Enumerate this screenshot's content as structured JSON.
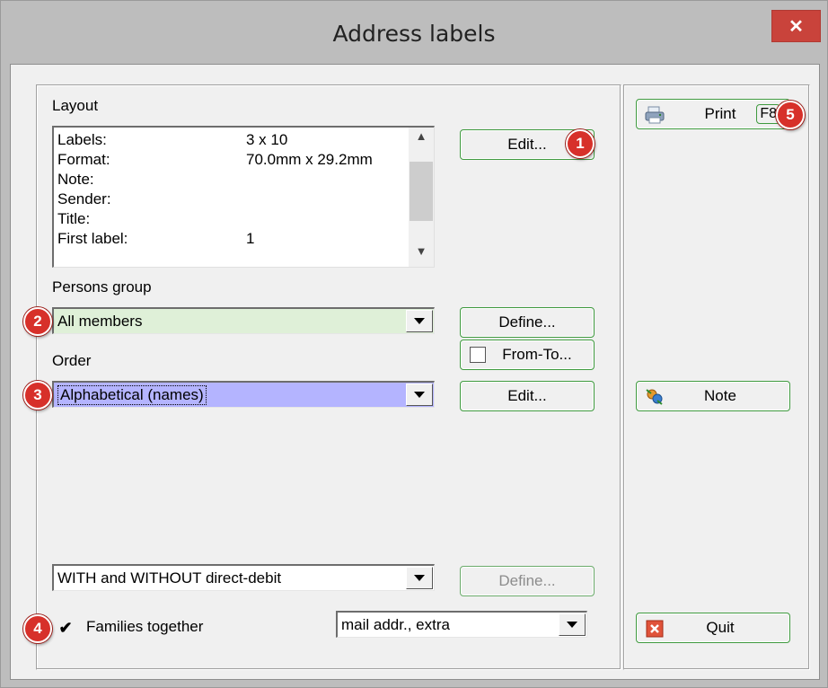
{
  "window": {
    "title": "Address labels",
    "close_glyph": "✕"
  },
  "layout": {
    "label": "Layout",
    "rows": [
      {
        "key": "Labels:",
        "value": "3 x 10"
      },
      {
        "key": "Format:",
        "value": "70.0mm x 29.2mm"
      },
      {
        "key": "Note:",
        "value": ""
      },
      {
        "key": "Sender:",
        "value": ""
      },
      {
        "key": "Title:",
        "value": ""
      },
      {
        "key": "First label:",
        "value": "1"
      }
    ],
    "edit_label": "Edit..."
  },
  "persons_group": {
    "label": "Persons group",
    "value": "All members",
    "define_label": "Define...",
    "from_to_label": "From-To..."
  },
  "order": {
    "label": "Order",
    "value": "Alphabetical (names)",
    "edit_label": "Edit..."
  },
  "debit": {
    "value": "WITH and WITHOUT direct-debit",
    "define_label": "Define..."
  },
  "families": {
    "label": "Families together",
    "checked": true,
    "address_value": "mail addr., extra"
  },
  "actions": {
    "print_label": "Print",
    "print_key": "F8",
    "note_label": "Note",
    "quit_label": "Quit"
  },
  "badges": [
    "1",
    "2",
    "3",
    "4",
    "5"
  ],
  "colors": {
    "persons_bg": "#dff0d8",
    "order_bg": "#b4b4ff",
    "accent_border": "#3f9a3f",
    "badge": "#d7302a",
    "close": "#c9433b"
  }
}
